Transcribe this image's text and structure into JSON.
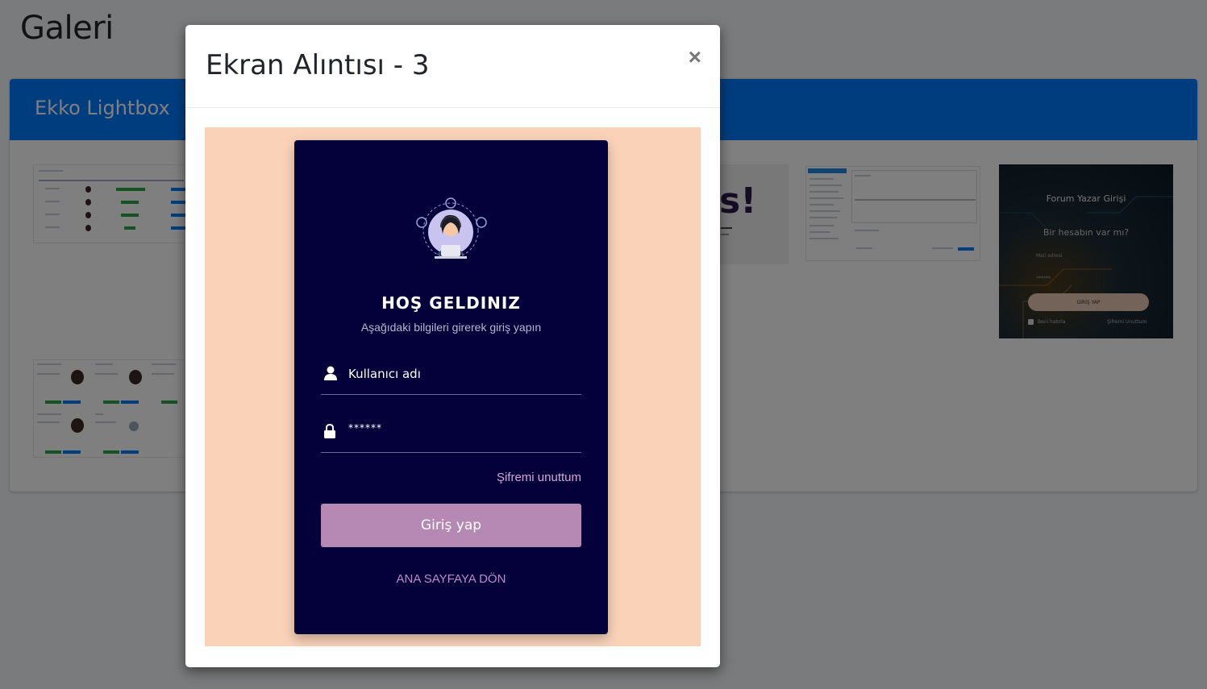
{
  "page": {
    "title": "Galeri"
  },
  "card": {
    "title": "Ekko Lightbox",
    "header_color": "#007bff"
  },
  "thumbnails": {
    "forum_login": {
      "title": "Forum Yazar Girişi",
      "subtitle": "Bir hesabın var mı?",
      "email_label": "Mail adresi",
      "password_mask": "******",
      "button": "GİRİŞ YAP",
      "remember": "Beni hatırla",
      "forgot": "Şifremi Unuttum"
    }
  },
  "modal": {
    "title": "Ekran Alıntısı - 3",
    "close_icon": "close-icon",
    "close_symbol": "×"
  },
  "login_screen": {
    "background_color": "#f9d2b8",
    "panel_color": "#04003a",
    "heading": "HOŞ GELDINIZ",
    "subheading": "Aşağıdaki bilgileri girerek giriş yapın",
    "username_placeholder": "Kullanıcı adı",
    "password_mask": "******",
    "forgot_password": "Şifremi unuttum",
    "login_button": "Giriş yap",
    "back_home": "ANA SAYFAYA DÖN",
    "button_color": "#b689b4"
  }
}
